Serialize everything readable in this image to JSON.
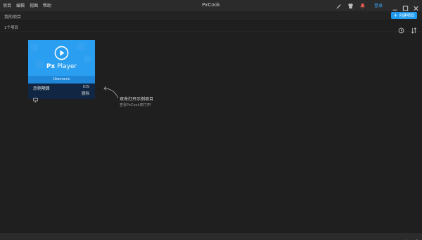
{
  "titlebar": {
    "menu": [
      "项目",
      "编辑",
      "视图",
      "帮助"
    ],
    "app_title": "PxCook",
    "login_label": "登录"
  },
  "subbar": {
    "label": "我的项目",
    "new_project_label": "创建项目"
  },
  "toolbar": {
    "project_count": "1个项目"
  },
  "project_card": {
    "brand_prefix": "Px",
    "brand_name": "Player",
    "creator": "Utemonic",
    "name": "示例项目",
    "platform": "iOS",
    "delete_label": "删除"
  },
  "hint": {
    "title": "双击打开示例项目",
    "description": "查看PxCook来打开!"
  },
  "colors": {
    "accent": "#1e9bef",
    "card_thumb": "#2a9ef0",
    "card_info": "#102642",
    "background": "#1f1f1f"
  }
}
